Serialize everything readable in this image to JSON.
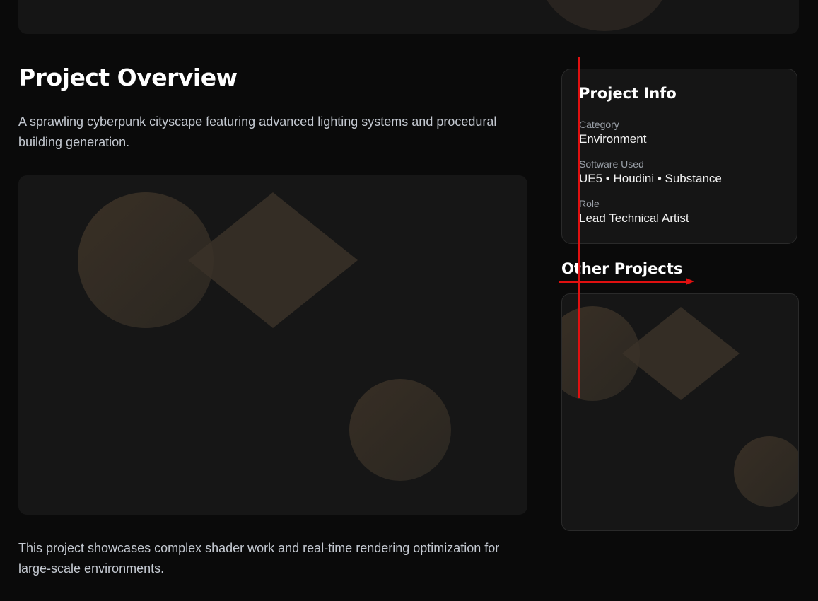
{
  "overview": {
    "title": "Project Overview",
    "intro": "A sprawling cyberpunk cityscape featuring advanced lighting systems and procedural building generation.",
    "outro": "This project showcases complex shader work and real-time rendering optimization for large-scale environments."
  },
  "project_info": {
    "title": "Project Info",
    "fields": [
      {
        "label": "Category",
        "value": "Environment"
      },
      {
        "label": "Software Used",
        "value": "UE5 • Houdini • Substance"
      },
      {
        "label": "Role",
        "value": "Lead Technical Artist"
      }
    ]
  },
  "other_projects": {
    "title": "Other Projects"
  },
  "colors": {
    "background": "#0a0a0a",
    "card": "#151515",
    "shape": "#3a3128",
    "annotation": "#e01010"
  }
}
